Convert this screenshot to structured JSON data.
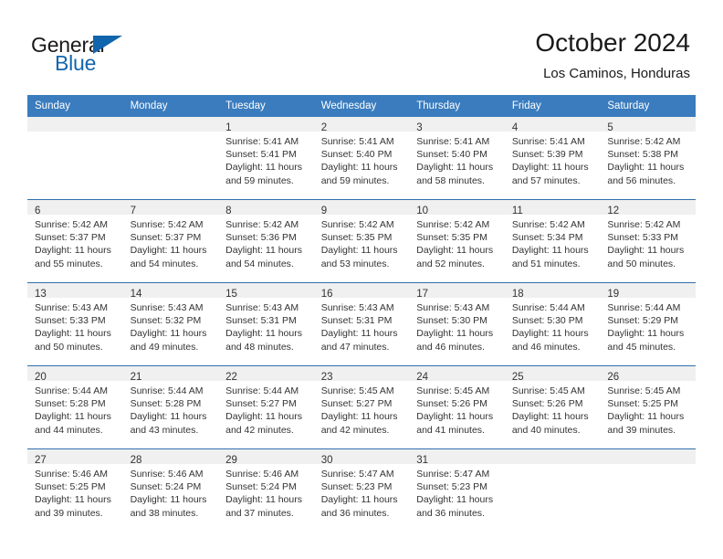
{
  "brand": {
    "word_general": "General",
    "word_blue": "Blue",
    "icon": "triangle-logo"
  },
  "header": {
    "title": "October 2024",
    "location": "Los Caminos, Honduras"
  },
  "calendar": {
    "weekday_headers": [
      "Sunday",
      "Monday",
      "Tuesday",
      "Wednesday",
      "Thursday",
      "Friday",
      "Saturday"
    ],
    "accent_header_color": "#3a7cbe",
    "row_divider_color": "#2f6fab",
    "daynum_band_color": "#f0f0f0",
    "weeks": [
      [
        {
          "day": "",
          "empty": true
        },
        {
          "day": "",
          "empty": true
        },
        {
          "day": "1",
          "sunrise": "Sunrise: 5:41 AM",
          "sunset": "Sunset: 5:41 PM",
          "daylight1": "Daylight: 11 hours",
          "daylight2": "and 59 minutes."
        },
        {
          "day": "2",
          "sunrise": "Sunrise: 5:41 AM",
          "sunset": "Sunset: 5:40 PM",
          "daylight1": "Daylight: 11 hours",
          "daylight2": "and 59 minutes."
        },
        {
          "day": "3",
          "sunrise": "Sunrise: 5:41 AM",
          "sunset": "Sunset: 5:40 PM",
          "daylight1": "Daylight: 11 hours",
          "daylight2": "and 58 minutes."
        },
        {
          "day": "4",
          "sunrise": "Sunrise: 5:41 AM",
          "sunset": "Sunset: 5:39 PM",
          "daylight1": "Daylight: 11 hours",
          "daylight2": "and 57 minutes."
        },
        {
          "day": "5",
          "sunrise": "Sunrise: 5:42 AM",
          "sunset": "Sunset: 5:38 PM",
          "daylight1": "Daylight: 11 hours",
          "daylight2": "and 56 minutes."
        }
      ],
      [
        {
          "day": "6",
          "sunrise": "Sunrise: 5:42 AM",
          "sunset": "Sunset: 5:37 PM",
          "daylight1": "Daylight: 11 hours",
          "daylight2": "and 55 minutes."
        },
        {
          "day": "7",
          "sunrise": "Sunrise: 5:42 AM",
          "sunset": "Sunset: 5:37 PM",
          "daylight1": "Daylight: 11 hours",
          "daylight2": "and 54 minutes."
        },
        {
          "day": "8",
          "sunrise": "Sunrise: 5:42 AM",
          "sunset": "Sunset: 5:36 PM",
          "daylight1": "Daylight: 11 hours",
          "daylight2": "and 54 minutes."
        },
        {
          "day": "9",
          "sunrise": "Sunrise: 5:42 AM",
          "sunset": "Sunset: 5:35 PM",
          "daylight1": "Daylight: 11 hours",
          "daylight2": "and 53 minutes."
        },
        {
          "day": "10",
          "sunrise": "Sunrise: 5:42 AM",
          "sunset": "Sunset: 5:35 PM",
          "daylight1": "Daylight: 11 hours",
          "daylight2": "and 52 minutes."
        },
        {
          "day": "11",
          "sunrise": "Sunrise: 5:42 AM",
          "sunset": "Sunset: 5:34 PM",
          "daylight1": "Daylight: 11 hours",
          "daylight2": "and 51 minutes."
        },
        {
          "day": "12",
          "sunrise": "Sunrise: 5:42 AM",
          "sunset": "Sunset: 5:33 PM",
          "daylight1": "Daylight: 11 hours",
          "daylight2": "and 50 minutes."
        }
      ],
      [
        {
          "day": "13",
          "sunrise": "Sunrise: 5:43 AM",
          "sunset": "Sunset: 5:33 PM",
          "daylight1": "Daylight: 11 hours",
          "daylight2": "and 50 minutes."
        },
        {
          "day": "14",
          "sunrise": "Sunrise: 5:43 AM",
          "sunset": "Sunset: 5:32 PM",
          "daylight1": "Daylight: 11 hours",
          "daylight2": "and 49 minutes."
        },
        {
          "day": "15",
          "sunrise": "Sunrise: 5:43 AM",
          "sunset": "Sunset: 5:31 PM",
          "daylight1": "Daylight: 11 hours",
          "daylight2": "and 48 minutes."
        },
        {
          "day": "16",
          "sunrise": "Sunrise: 5:43 AM",
          "sunset": "Sunset: 5:31 PM",
          "daylight1": "Daylight: 11 hours",
          "daylight2": "and 47 minutes."
        },
        {
          "day": "17",
          "sunrise": "Sunrise: 5:43 AM",
          "sunset": "Sunset: 5:30 PM",
          "daylight1": "Daylight: 11 hours",
          "daylight2": "and 46 minutes."
        },
        {
          "day": "18",
          "sunrise": "Sunrise: 5:44 AM",
          "sunset": "Sunset: 5:30 PM",
          "daylight1": "Daylight: 11 hours",
          "daylight2": "and 46 minutes."
        },
        {
          "day": "19",
          "sunrise": "Sunrise: 5:44 AM",
          "sunset": "Sunset: 5:29 PM",
          "daylight1": "Daylight: 11 hours",
          "daylight2": "and 45 minutes."
        }
      ],
      [
        {
          "day": "20",
          "sunrise": "Sunrise: 5:44 AM",
          "sunset": "Sunset: 5:28 PM",
          "daylight1": "Daylight: 11 hours",
          "daylight2": "and 44 minutes."
        },
        {
          "day": "21",
          "sunrise": "Sunrise: 5:44 AM",
          "sunset": "Sunset: 5:28 PM",
          "daylight1": "Daylight: 11 hours",
          "daylight2": "and 43 minutes."
        },
        {
          "day": "22",
          "sunrise": "Sunrise: 5:44 AM",
          "sunset": "Sunset: 5:27 PM",
          "daylight1": "Daylight: 11 hours",
          "daylight2": "and 42 minutes."
        },
        {
          "day": "23",
          "sunrise": "Sunrise: 5:45 AM",
          "sunset": "Sunset: 5:27 PM",
          "daylight1": "Daylight: 11 hours",
          "daylight2": "and 42 minutes."
        },
        {
          "day": "24",
          "sunrise": "Sunrise: 5:45 AM",
          "sunset": "Sunset: 5:26 PM",
          "daylight1": "Daylight: 11 hours",
          "daylight2": "and 41 minutes."
        },
        {
          "day": "25",
          "sunrise": "Sunrise: 5:45 AM",
          "sunset": "Sunset: 5:26 PM",
          "daylight1": "Daylight: 11 hours",
          "daylight2": "and 40 minutes."
        },
        {
          "day": "26",
          "sunrise": "Sunrise: 5:45 AM",
          "sunset": "Sunset: 5:25 PM",
          "daylight1": "Daylight: 11 hours",
          "daylight2": "and 39 minutes."
        }
      ],
      [
        {
          "day": "27",
          "sunrise": "Sunrise: 5:46 AM",
          "sunset": "Sunset: 5:25 PM",
          "daylight1": "Daylight: 11 hours",
          "daylight2": "and 39 minutes."
        },
        {
          "day": "28",
          "sunrise": "Sunrise: 5:46 AM",
          "sunset": "Sunset: 5:24 PM",
          "daylight1": "Daylight: 11 hours",
          "daylight2": "and 38 minutes."
        },
        {
          "day": "29",
          "sunrise": "Sunrise: 5:46 AM",
          "sunset": "Sunset: 5:24 PM",
          "daylight1": "Daylight: 11 hours",
          "daylight2": "and 37 minutes."
        },
        {
          "day": "30",
          "sunrise": "Sunrise: 5:47 AM",
          "sunset": "Sunset: 5:23 PM",
          "daylight1": "Daylight: 11 hours",
          "daylight2": "and 36 minutes."
        },
        {
          "day": "31",
          "sunrise": "Sunrise: 5:47 AM",
          "sunset": "Sunset: 5:23 PM",
          "daylight1": "Daylight: 11 hours",
          "daylight2": "and 36 minutes."
        },
        {
          "day": "",
          "empty": true
        },
        {
          "day": "",
          "empty": true
        }
      ]
    ]
  }
}
